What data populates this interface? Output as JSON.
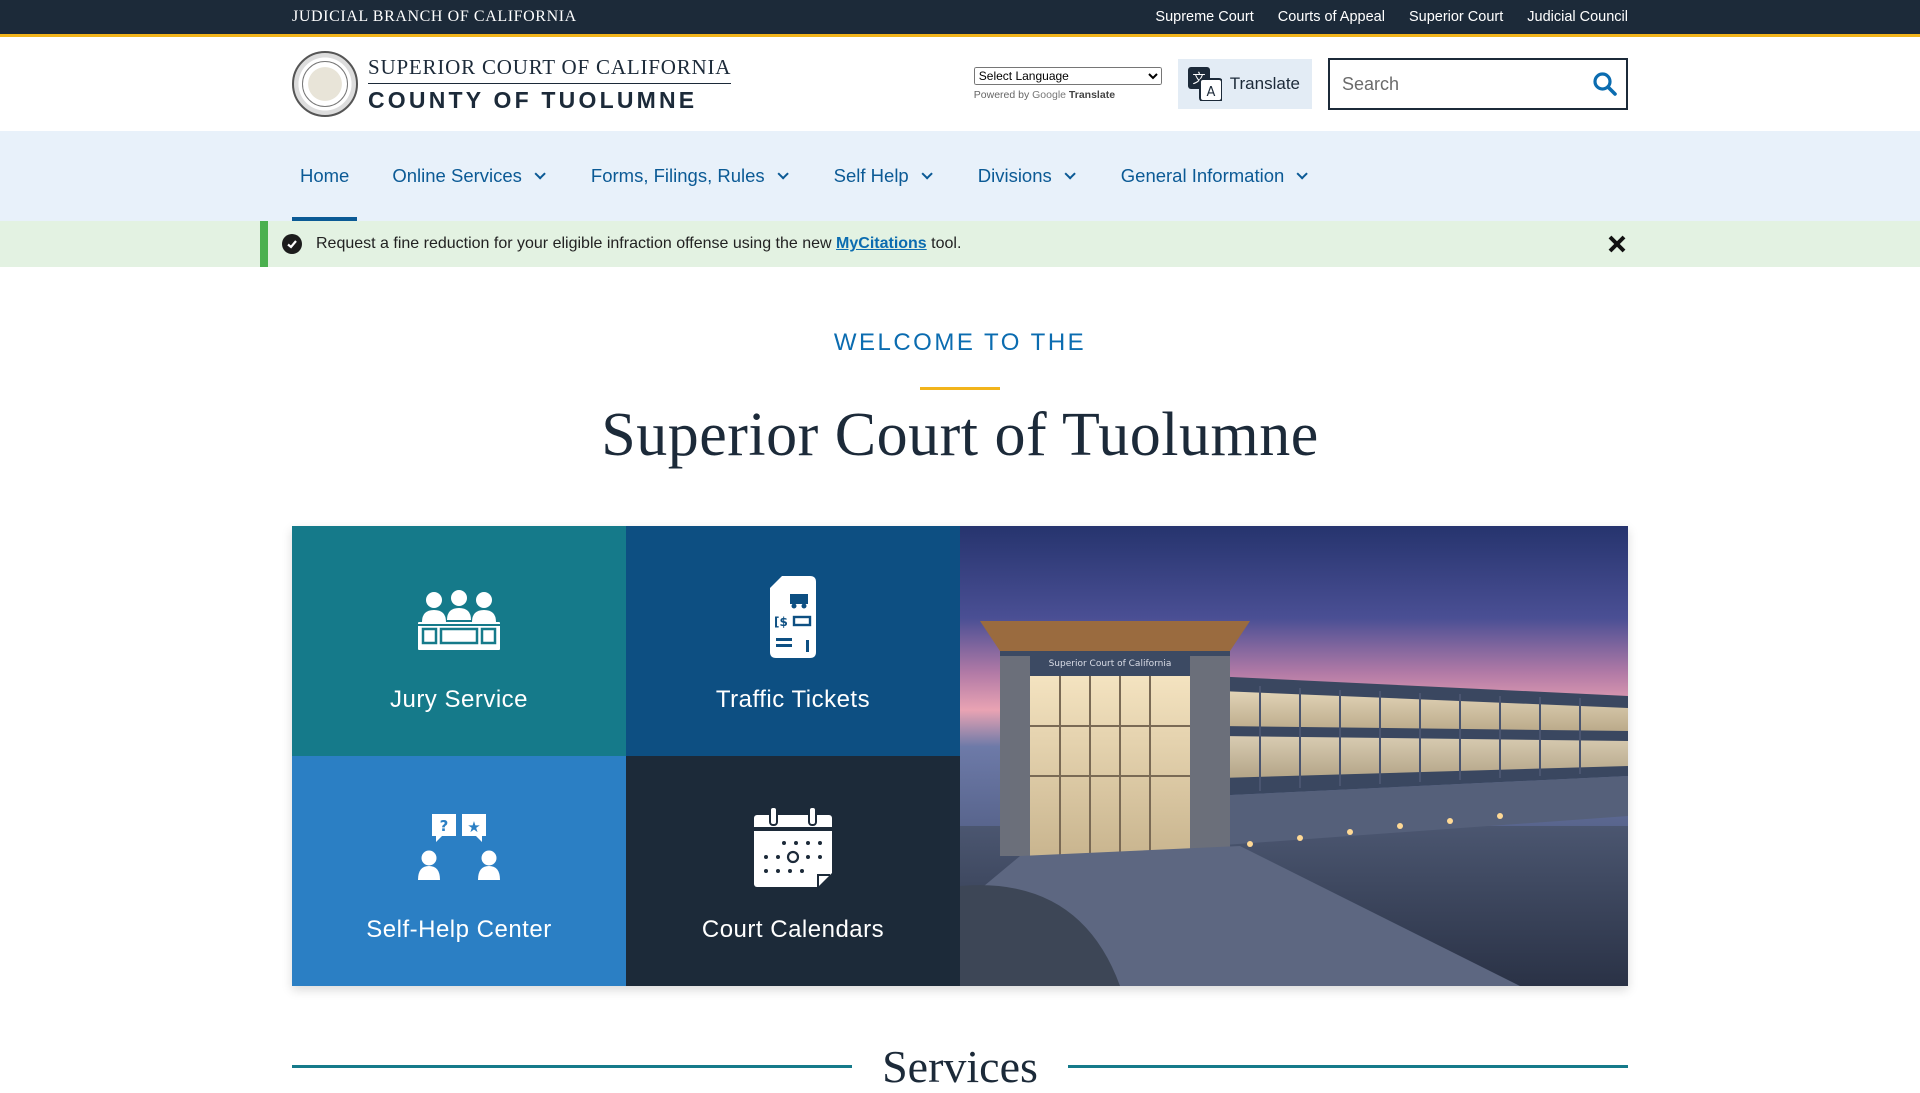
{
  "topbar": {
    "brand": "Judicial Branch of California",
    "links": [
      "Supreme Court",
      "Courts of Appeal",
      "Superior Court",
      "Judicial Council"
    ]
  },
  "header": {
    "logo_line1": "Superior Court of California",
    "logo_line2": "County of Tuolumne",
    "language_select": "Select Language",
    "powered_by": "Powered by",
    "google": "Google",
    "translate_word": "Translate",
    "translate_button": "Translate",
    "search_placeholder": "Search"
  },
  "nav": {
    "items": [
      {
        "label": "Home",
        "active": true,
        "dropdown": false
      },
      {
        "label": "Online Services",
        "dropdown": true
      },
      {
        "label": "Forms, Filings, Rules",
        "dropdown": true
      },
      {
        "label": "Self Help",
        "dropdown": true
      },
      {
        "label": "Divisions",
        "dropdown": true
      },
      {
        "label": "General Information",
        "dropdown": true
      }
    ]
  },
  "alert": {
    "text_before": "Request a fine reduction for your eligible infraction offense using the new ",
    "link": "MyCitations",
    "text_after": " tool."
  },
  "welcome": {
    "kicker": "Welcome to the",
    "title": "Superior Court of Tuolumne"
  },
  "tiles": [
    {
      "label": "Jury Service",
      "icon": "jury-icon",
      "color": "#157a8a"
    },
    {
      "label": "Traffic Tickets",
      "icon": "traffic-ticket-icon",
      "color": "#0d4f82"
    },
    {
      "label": "Self-Help Center",
      "icon": "self-help-icon",
      "color": "#2b7fc4"
    },
    {
      "label": "Court Calendars",
      "icon": "calendar-icon",
      "color": "#1c2a39"
    }
  ],
  "photo": {
    "sign_text": "Superior Court of California"
  },
  "services": {
    "title": "Services"
  },
  "colors": {
    "navy": "#1c2a39",
    "gold": "#f2b41b",
    "link_blue": "#0b5a95",
    "alert_green": "#4bb04f"
  }
}
